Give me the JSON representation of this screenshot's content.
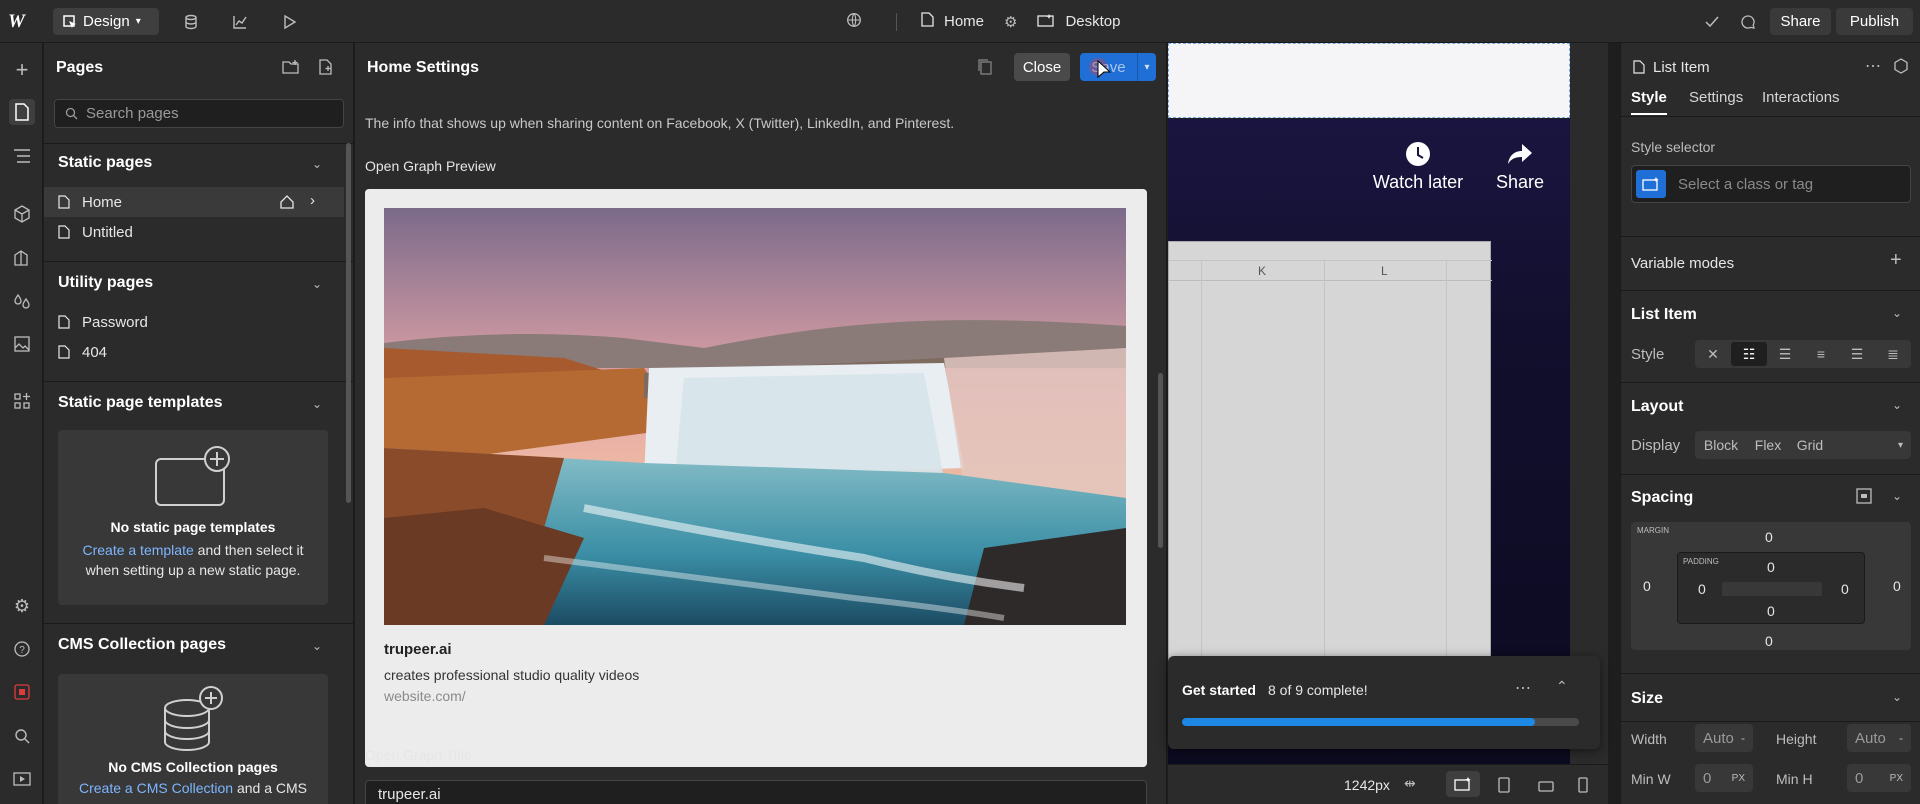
{
  "topbar": {
    "mode_label": "Design",
    "page_label": "Home",
    "breakpoint_label": "Desktop",
    "share_label": "Share",
    "publish_label": "Publish"
  },
  "pages_panel": {
    "title": "Pages",
    "search_placeholder": "Search pages",
    "static_title": "Static pages",
    "static_items": [
      "Home",
      "Untitled"
    ],
    "utility_title": "Utility pages",
    "utility_items": [
      "Password",
      "404"
    ],
    "templates_title": "Static page templates",
    "templates_empty_title": "No static page templates",
    "templates_link": "Create a template",
    "templates_text": " and then select it when setting up a new static page.",
    "cms_title": "CMS Collection pages",
    "cms_empty_title": "No CMS Collection pages",
    "cms_link": "Create a CMS Collection",
    "cms_text": " and a CMS"
  },
  "settings": {
    "title": "Home Settings",
    "close_label": "Close",
    "save_label": "Save",
    "description": "The info that shows up when sharing content on Facebook, X (Twitter), LinkedIn, and Pinterest.",
    "og_preview_label": "Open Graph Preview",
    "og_site": "trupeer.ai",
    "og_desc": "creates professional studio quality videos",
    "og_url": "website.com/",
    "og_title_label": "Open Graph Title",
    "og_title_value": "trupeer.ai"
  },
  "canvas": {
    "watch_later": "Watch later",
    "share": "Share",
    "col_k": "K",
    "col_l": "L",
    "width_readout": "1242px"
  },
  "get_started": {
    "title": "Get started",
    "status": "8 of 9 complete!",
    "progress": 0.89
  },
  "right_panel": {
    "element_name": "List Item",
    "tabs": [
      "Style",
      "Settings",
      "Interactions"
    ],
    "style_selector_label": "Style selector",
    "style_selector_placeholder": "Select a class or tag",
    "variable_modes": "Variable modes",
    "list_item_title": "List Item",
    "style_label": "Style",
    "layout_title": "Layout",
    "display_label": "Display",
    "display_options": [
      "Block",
      "Flex",
      "Grid"
    ],
    "spacing_title": "Spacing",
    "margin_label": "MARGIN",
    "padding_label": "PADDING",
    "margin": {
      "top": "0",
      "right": "0",
      "bottom": "0",
      "left": "0"
    },
    "padding": {
      "top": "0",
      "right": "0",
      "bottom": "0",
      "left": "0"
    },
    "size_title": "Size",
    "width_label": "Width",
    "width_value": "Auto",
    "height_label": "Height",
    "height_value": "Auto",
    "minw_label": "Min W",
    "minw_value": "0",
    "minh_label": "Min H",
    "minh_value": "0",
    "unit_px": "PX",
    "unit_dash": "-"
  },
  "colors": {
    "accent": "#1f6fd6",
    "progress": "#1e88e5",
    "link": "#7eb6ff",
    "canvas_dark": "#1a1540"
  }
}
